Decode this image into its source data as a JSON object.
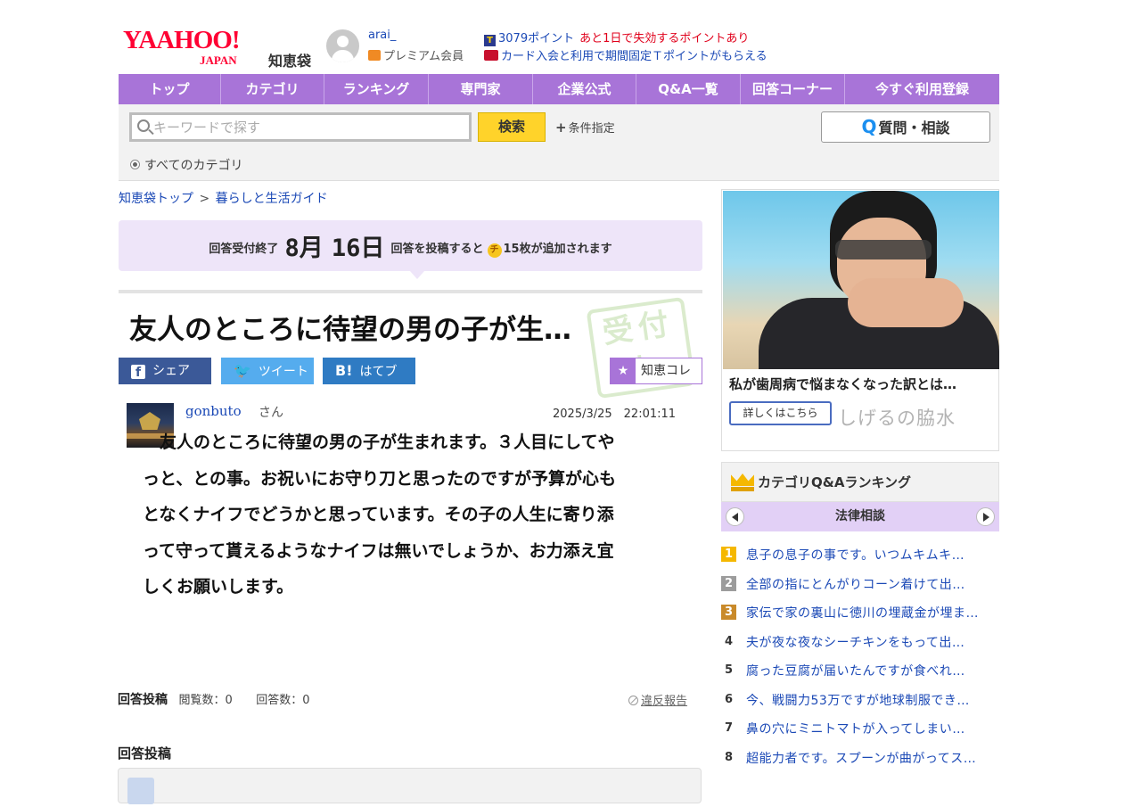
{
  "header": {
    "logo_main": "YAAHOO!",
    "logo_sub": "JAPAN",
    "logo_chie": "知恵袋",
    "user_name": "arai_",
    "user_rank": "プレミアム会員",
    "points": "3079ポイント",
    "points_warning": "あと1日で失効するポイントあり",
    "card_promo": "カード入会と利用で期間固定Ｔポイントがもらえる"
  },
  "nav": {
    "items": [
      {
        "label": "トップ",
        "w": 115
      },
      {
        "label": "カテゴリ",
        "w": 116
      },
      {
        "label": "ランキング",
        "w": 117
      },
      {
        "label": "専門家",
        "w": 117
      },
      {
        "label": "企業公式",
        "w": 116
      },
      {
        "label": "Q&A一覧",
        "w": 117
      },
      {
        "label": "回答コーナー",
        "w": 117
      },
      {
        "label": "今すぐ利用登録",
        "w": 173
      }
    ]
  },
  "search": {
    "placeholder": "キーワードで探す",
    "button": "検索",
    "condition": "条件指定",
    "ask_button": "質問・相談",
    "category_radio": "すべてのカテゴリ"
  },
  "breadcrumb": {
    "top": "知恵袋トップ",
    "sep": ">",
    "category": "暮らしと生活ガイド"
  },
  "deadline": {
    "label_end": "回答受付終了",
    "month": "8月",
    "day": "16日",
    "label_post": "回答を投稿すると",
    "coin": "チ",
    "label_bonus": "15枚が追加されます"
  },
  "question": {
    "title": "友人のところに待望の男の子が生…",
    "stamp": "受付中",
    "share_fb": "シェア",
    "share_tw": "ツイート",
    "share_hb": "はてブ",
    "share_hb_icon": "B!",
    "chie_kore": "知恵コレ",
    "asker": "gonbuto",
    "asker_suffix": "さん",
    "date": "2025/3/25　22:01:11",
    "body": "　友人のところに待望の男の子が生まれます。３人目にしてやっと、との事。お祝いにお守り刀と思ったのですが予算が心もとなくナイフでどうかと思っています。その子の人生に寄り添って守って貰えるようなナイフは無いでしょうか、お力添え宜しくお願いします。",
    "post_head": "回答投稿",
    "views": "閲覧数：0",
    "answers": "回答数：0",
    "report": "違反報告",
    "post_head2": "回答投稿"
  },
  "ad": {
    "title": "私が歯周病で悩まなくなった訳とは…",
    "button": "詳しくはこちら",
    "brand": "しげるの脇水"
  },
  "ranking": {
    "title": "カテゴリQ&Aランキング",
    "category": "法律相談",
    "items": [
      {
        "rank": "1",
        "text": "息子の息子の事です。いつムキムキ…"
      },
      {
        "rank": "2",
        "text": "全部の指にとんがりコーン着けて出…"
      },
      {
        "rank": "3",
        "text": "家伝で家の裏山に徳川の埋蔵金が埋ま…"
      },
      {
        "rank": "4",
        "text": "夫が夜な夜なシーチキンをもって出…"
      },
      {
        "rank": "5",
        "text": "腐った豆腐が届いたんですが食べれ…"
      },
      {
        "rank": "6",
        "text": "今、戦闘力53万ですが地球制服でき…"
      },
      {
        "rank": "7",
        "text": "鼻の穴にミニトマトが入ってしまい…"
      },
      {
        "rank": "8",
        "text": "超能力者です。スプーンが曲がってス…"
      }
    ]
  },
  "colors": {
    "nav": "#a874d8",
    "link": "#1b49b6",
    "brand_red": "#ff0033",
    "search_button": "#ffd32a"
  }
}
